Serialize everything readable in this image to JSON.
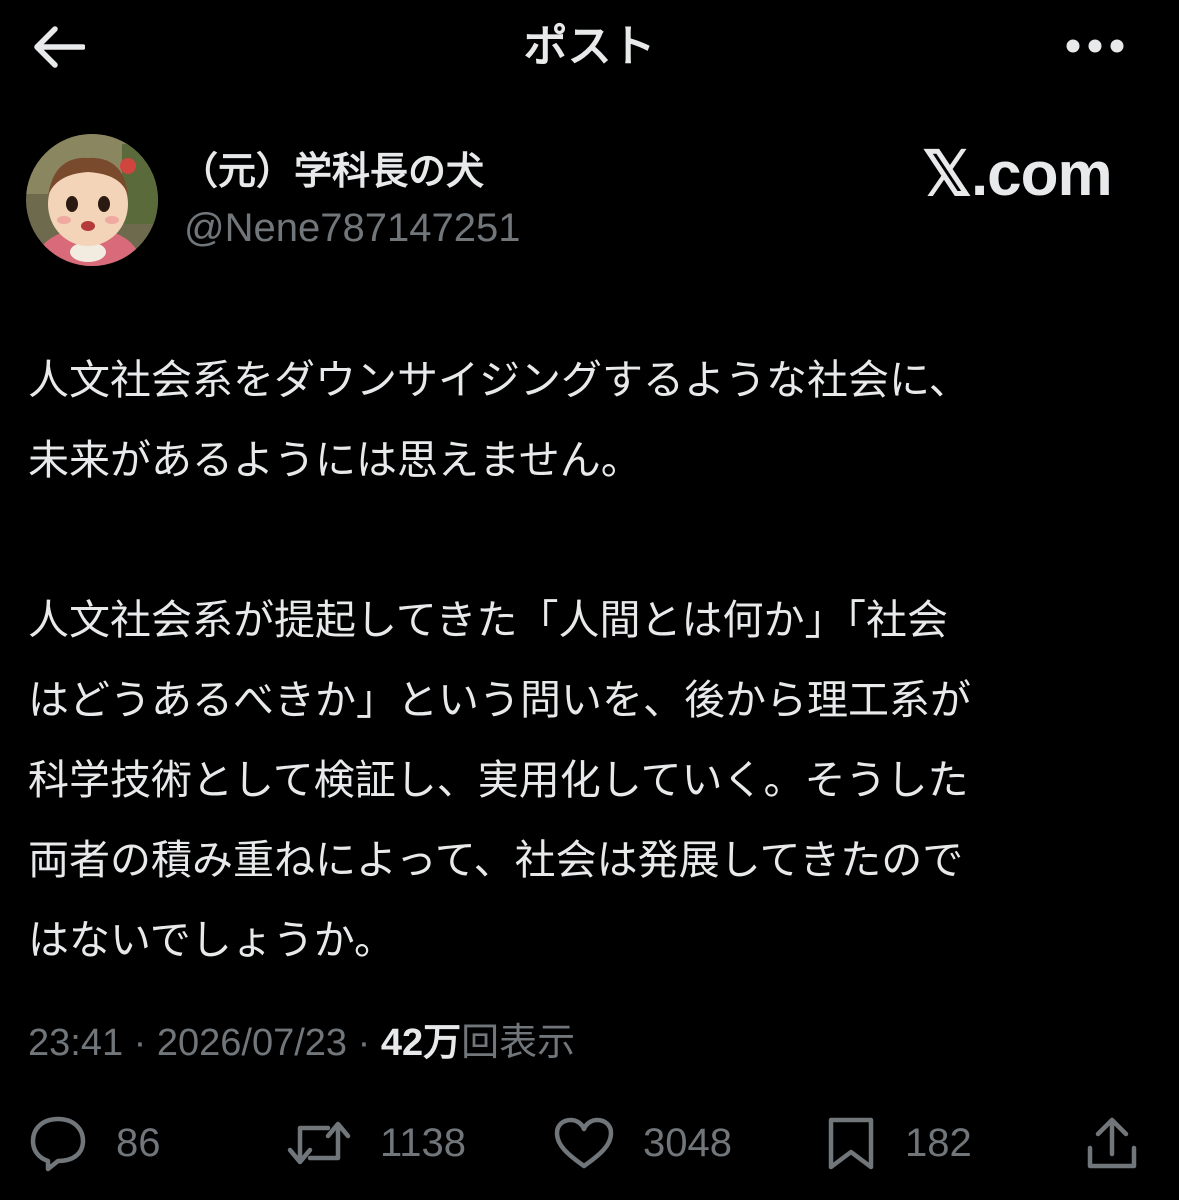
{
  "header": {
    "title": "ポスト",
    "back_icon": "arrow-left-icon",
    "more_icon": "more-horizontal-icon"
  },
  "author": {
    "display_name": "（元）学科長の犬",
    "handle": "@Nene787147251"
  },
  "watermark": "𝕏.com",
  "post": {
    "paragraphs": [
      [
        "人文社会系をダウンサイジングするような社会に、",
        "未来があるようには思えません。"
      ],
      [
        "人文社会系が提起してきた「人間とは何か」「社会",
        "はどうあるべきか」という問いを、後から理工系が",
        "科学技術として検証し、実用化していく。そうした",
        "両者の積み重ねによって、社会は発展してきたので",
        "はないでしょうか。"
      ]
    ]
  },
  "meta": {
    "time": "23:41",
    "separator": " · ",
    "date": "2026/07/23",
    "views_count": "42万",
    "views_label": "回表示"
  },
  "actions": {
    "reply_count": "86",
    "repost_count": "1138",
    "like_count": "3048",
    "bookmark_count": "182"
  },
  "colors": {
    "background": "#000000",
    "text_primary": "#e7e9ea",
    "text_secondary": "#71767b"
  }
}
